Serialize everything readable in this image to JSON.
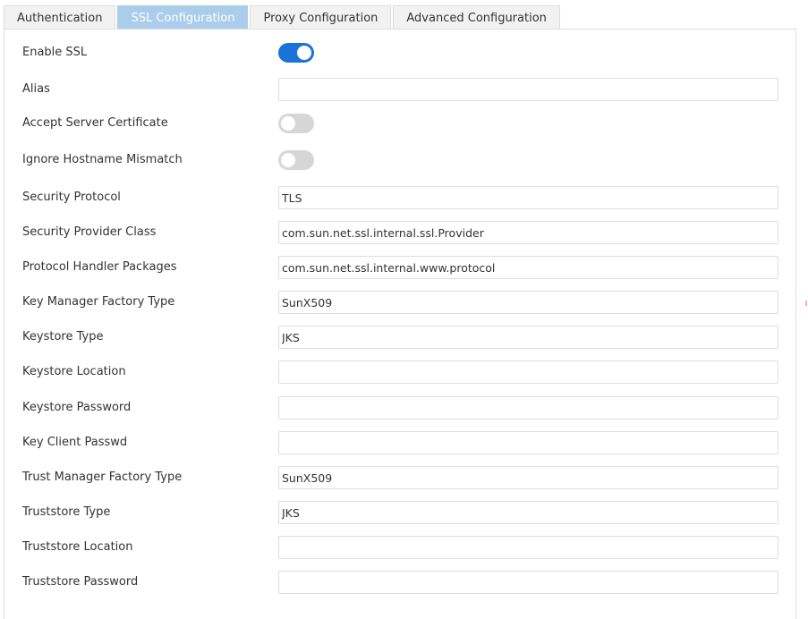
{
  "tabs": [
    {
      "label": "Authentication",
      "active": false
    },
    {
      "label": "SSL Configuration",
      "active": true
    },
    {
      "label": "Proxy Configuration",
      "active": false
    },
    {
      "label": "Advanced Configuration",
      "active": false
    }
  ],
  "form": {
    "enable_ssl": {
      "label": "Enable SSL",
      "on": true
    },
    "alias": {
      "label": "Alias",
      "value": ""
    },
    "accept_server_certificate": {
      "label": "Accept Server Certificate",
      "on": false
    },
    "ignore_hostname_mismatch": {
      "label": "Ignore Hostname Mismatch",
      "on": false
    },
    "security_protocol": {
      "label": "Security Protocol",
      "value": "TLS"
    },
    "security_provider_class": {
      "label": "Security Provider Class",
      "value": "com.sun.net.ssl.internal.ssl.Provider"
    },
    "protocol_handler_packages": {
      "label": "Protocol Handler Packages",
      "value": "com.sun.net.ssl.internal.www.protocol"
    },
    "key_manager_factory_type": {
      "label": "Key Manager Factory Type",
      "value": "SunX509"
    },
    "keystore_type": {
      "label": "Keystore Type",
      "value": "JKS"
    },
    "keystore_location": {
      "label": "Keystore Location",
      "value": ""
    },
    "keystore_password": {
      "label": "Keystore Password",
      "value": ""
    },
    "key_client_passwd": {
      "label": "Key Client Passwd",
      "value": ""
    },
    "trust_manager_factory_type": {
      "label": "Trust Manager Factory Type",
      "value": "SunX509"
    },
    "truststore_type": {
      "label": "Truststore Type",
      "value": "JKS"
    },
    "truststore_location": {
      "label": "Truststore Location",
      "value": ""
    },
    "truststore_password": {
      "label": "Truststore Password",
      "value": ""
    }
  },
  "colors": {
    "accent": "#1a73d9",
    "active_tab": "#a9cdeb",
    "toggle_off": "#d6d6d6"
  }
}
